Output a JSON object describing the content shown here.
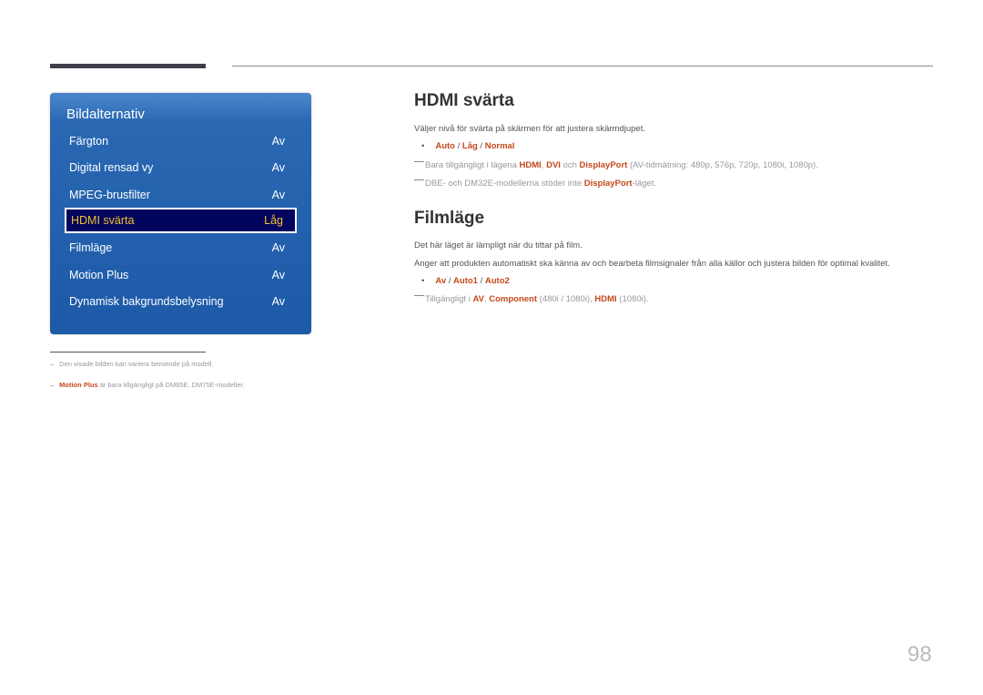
{
  "menu": {
    "title": "Bildalternativ",
    "items": [
      {
        "label": "Färgton",
        "value": "Av"
      },
      {
        "label": "Digital rensad vy",
        "value": "Av"
      },
      {
        "label": "MPEG-brusfilter",
        "value": "Av"
      },
      {
        "label": "HDMI svärta",
        "value": "Låg",
        "selected": true
      },
      {
        "label": "Filmläge",
        "value": "Av"
      },
      {
        "label": "Motion Plus",
        "value": "Av"
      },
      {
        "label": "Dynamisk bakgrundsbelysning",
        "value": "Av"
      }
    ]
  },
  "sections": {
    "hdmi": {
      "title": "HDMI svärta",
      "desc": "Väljer nivå för svärta på skärmen för att justera skärmdjupet.",
      "options": [
        "Auto",
        "Låg",
        "Normal"
      ],
      "note1": {
        "pre": "Bara tillgängligt i lägena ",
        "hdmi": "HDMI",
        "sep": ", ",
        "dvi": "DVI",
        "och": " och ",
        "dp": "DisplayPort",
        "post": " (AV-tidmätning: 480p, 576p, 720p, 1080i, 1080p)."
      },
      "note2": {
        "pre": "DBE- och DM32E-modellerna stöder inte ",
        "dp": "DisplayPort",
        "post": "-läget."
      }
    },
    "film": {
      "title": "Filmläge",
      "desc1": "Det här läget är lämpligt när du tittar på film.",
      "desc2": "Anger att produkten automatiskt ska känna av och bearbeta filmsignaler från alla källor och justera bilden för optimal kvalitet.",
      "options": [
        "Av",
        "Auto1",
        "Auto2"
      ],
      "note": {
        "pre": "Tillgängligt i ",
        "av": "AV",
        "sep": ", ",
        "comp": "Component",
        "mid": " (480i / 1080i), ",
        "hdmi": "HDMI",
        "post": " (1080i)."
      }
    }
  },
  "footnotes": {
    "f1": "Den visade bilden kan variera beroende på modell.",
    "f2_hl": "Motion Plus",
    "f2_rest": " är bara tillgängligt på DM65E, DM75E-modeller."
  },
  "option_sep": " / ",
  "bullet_char": "•",
  "footnote_mark": "–",
  "page_number": "98",
  "colors": {
    "accent": "#c5481a",
    "menu_blue": "#1c5aa8",
    "selected_bg": "#02045e",
    "selected_text": "#f2c12e"
  }
}
